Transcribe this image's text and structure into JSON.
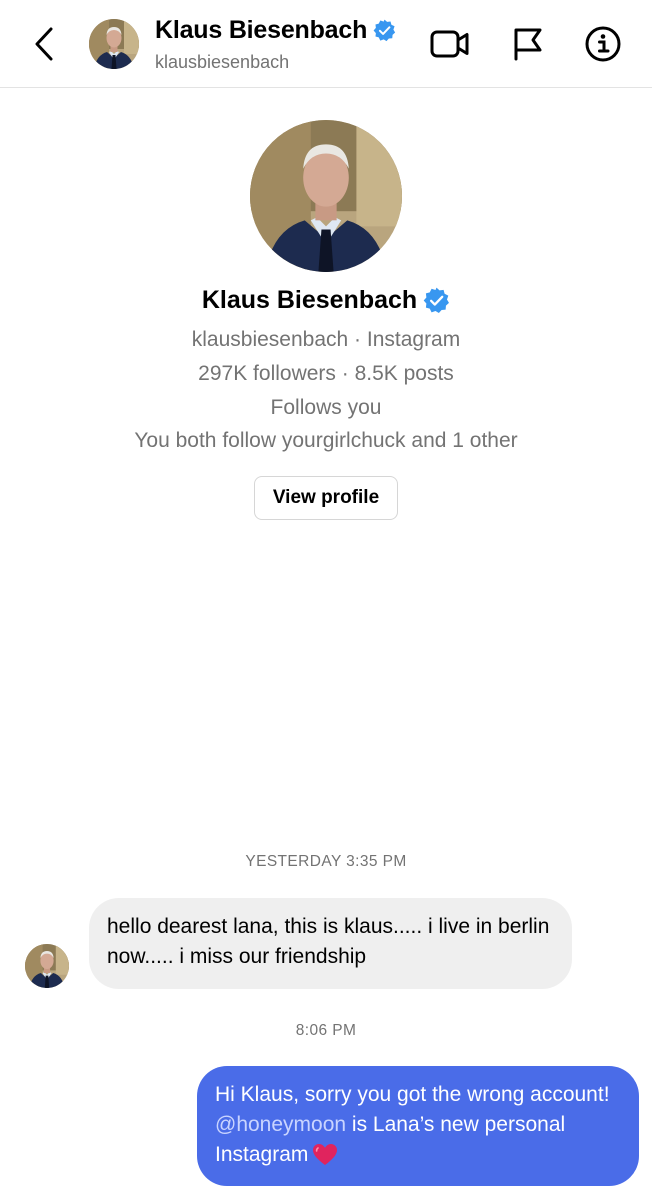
{
  "header": {
    "name": "Klaus Biesenbach",
    "username": "klausbiesenbach",
    "icons": {
      "back": "chevron-left-icon",
      "verified": "verified-badge-icon",
      "video": "video-call-icon",
      "flag": "flag-icon",
      "info": "info-icon"
    }
  },
  "profile": {
    "name": "Klaus Biesenbach",
    "subtitle": "klausbiesenbach · Instagram",
    "stats": "297K followers · 8.5K posts",
    "follows_status": "Follows you",
    "mutual": "You both follow yourgirlchuck and 1 other",
    "view_profile_label": "View profile"
  },
  "messages": {
    "timestamp_1": "YESTERDAY 3:35 PM",
    "incoming_text": "hello dearest lana, this is klaus..... i live in berlin now..... i miss our friendship",
    "timestamp_2": "8:06 PM",
    "outgoing_prefix": "Hi Klaus, sorry you got the wrong account! ",
    "outgoing_mention": "@honeymoon",
    "outgoing_suffix": " is Lana’s new personal Instagram",
    "outgoing_emoji": "heart-emoji-icon"
  },
  "colors": {
    "outgoing_bubble": "#4a6ce8",
    "incoming_bubble": "#efefef",
    "verified_blue": "#3897f0",
    "secondary_text": "#737373"
  }
}
